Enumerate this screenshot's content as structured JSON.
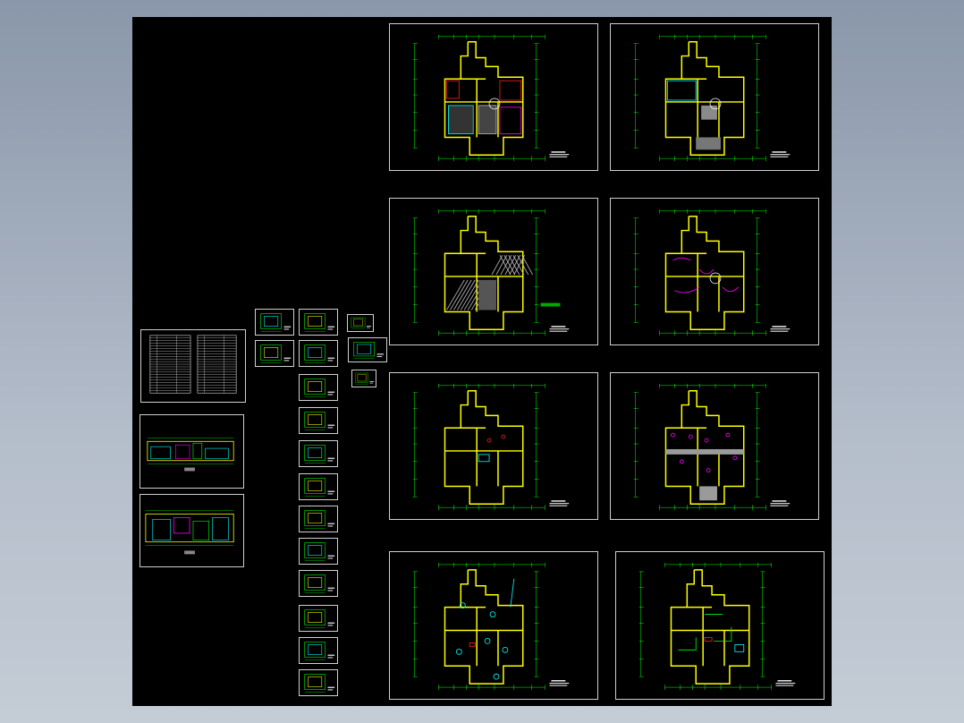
{
  "colors": {
    "background_top": "#8a97aa",
    "background_bottom": "#c4ccd6",
    "canvas": "#000000",
    "frame": "#cfcfcf",
    "wall": "#ffff00",
    "dimension": "#00ff00",
    "furniture": "#00ffff",
    "accent_red": "#ff2020",
    "accent_magenta": "#ff00ff",
    "hatch": "#bfbfbf"
  },
  "sheets": [
    {
      "id": "plan-1",
      "variant": "furniture"
    },
    {
      "id": "plan-2",
      "variant": "ceiling"
    },
    {
      "id": "plan-3",
      "variant": "floor"
    },
    {
      "id": "plan-4",
      "variant": "electric"
    },
    {
      "id": "plan-5",
      "variant": "walls"
    },
    {
      "id": "plan-6",
      "variant": "lighting"
    },
    {
      "id": "plan-7",
      "variant": "socket"
    },
    {
      "id": "plan-8",
      "variant": "water"
    }
  ]
}
